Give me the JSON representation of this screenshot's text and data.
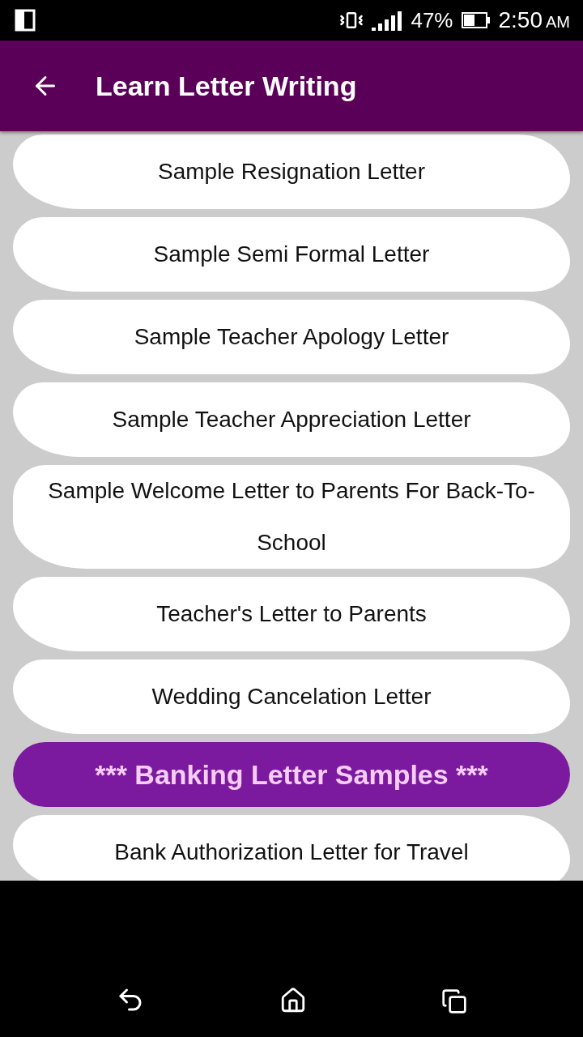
{
  "status_bar": {
    "battery": "47%",
    "time": "2:50",
    "ampm": "AM"
  },
  "app_bar": {
    "title": "Learn Letter Writing"
  },
  "items": [
    {
      "kind": "letter",
      "label": "Sample Resignation Letter"
    },
    {
      "kind": "letter",
      "label": "Sample Semi Formal Letter"
    },
    {
      "kind": "letter",
      "label": "Sample Teacher Apology Letter"
    },
    {
      "kind": "letter",
      "label": "Sample Teacher Appreciation Letter"
    },
    {
      "kind": "letter",
      "label": "Sample Welcome Letter to Parents For Back-To-School"
    },
    {
      "kind": "letter",
      "label": "Teacher's Letter to Parents"
    },
    {
      "kind": "letter",
      "label": "Wedding Cancelation Letter"
    },
    {
      "kind": "header",
      "label": "*** Banking Letter Samples ***"
    },
    {
      "kind": "letter",
      "label": "Bank Authorization Letter for Travel"
    }
  ]
}
